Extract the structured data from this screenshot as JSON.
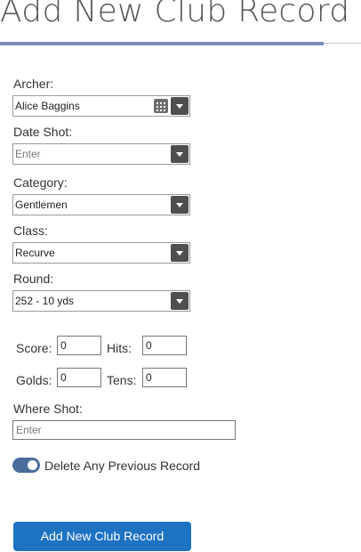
{
  "page": {
    "title": "Add New Club Record"
  },
  "form": {
    "archer": {
      "label": "Archer:",
      "value": "Alice Baggins"
    },
    "date_shot": {
      "label": "Date Shot:",
      "placeholder": "Enter"
    },
    "category": {
      "label": "Category:",
      "value": "Gentlemen"
    },
    "class": {
      "label": "Class:",
      "value": "Recurve"
    },
    "round": {
      "label": "Round:",
      "value": "252 - 10 yds"
    },
    "score": {
      "label": "Score:",
      "value": "0"
    },
    "hits": {
      "label": "Hits:",
      "value": "0"
    },
    "golds": {
      "label": "Golds:",
      "value": "0"
    },
    "tens": {
      "label": "Tens:",
      "value": "0"
    },
    "where_shot": {
      "label": "Where Shot:",
      "placeholder": "Enter"
    },
    "delete_previous": {
      "label": "Delete Any Previous Record",
      "checked": true
    },
    "submit_label": "Add New Club Record"
  },
  "colors": {
    "accent": "#1d72c2",
    "toggle_on": "#4a6d9c",
    "title_rule": "#7c8cba"
  },
  "icons": {
    "archer_picker": "grid-picker-icon",
    "dropdown": "chevron-down-icon"
  }
}
